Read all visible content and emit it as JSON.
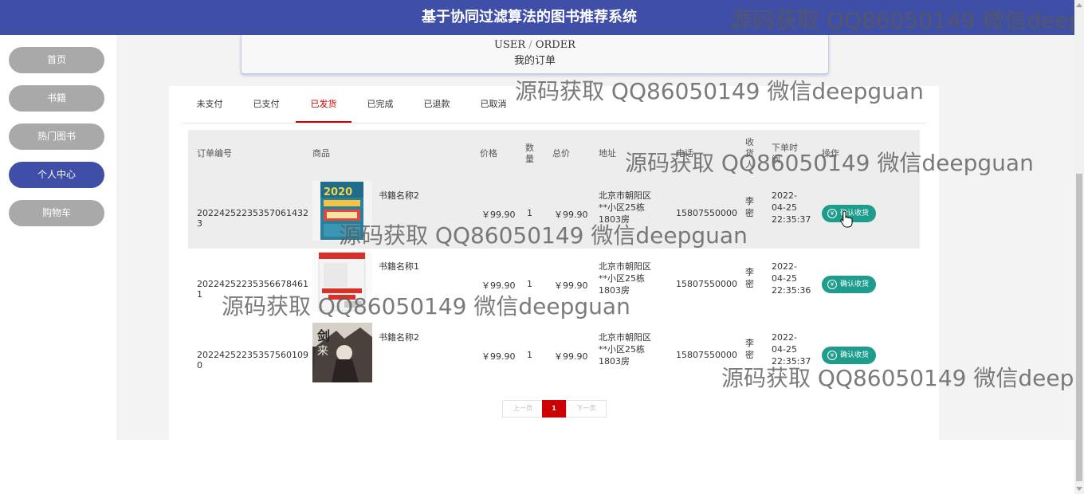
{
  "header": {
    "title": "基于协同过滤算法的图书推荐系统"
  },
  "sidebar": {
    "items": [
      {
        "label": "首页",
        "active": false
      },
      {
        "label": "书籍",
        "active": false
      },
      {
        "label": "热门图书",
        "active": false
      },
      {
        "label": "个人中心",
        "active": true
      },
      {
        "label": "购物车",
        "active": false
      }
    ]
  },
  "breadcrumb": {
    "user": "USER",
    "sep": "/",
    "order": "ORDER",
    "title": "我的订单"
  },
  "tabs": [
    {
      "label": "未支付",
      "active": false
    },
    {
      "label": "已支付",
      "active": false
    },
    {
      "label": "已发货",
      "active": true
    },
    {
      "label": "已完成",
      "active": false
    },
    {
      "label": "已退款",
      "active": false
    },
    {
      "label": "已取消",
      "active": false
    }
  ],
  "table": {
    "headers": {
      "order_no": "订单编号",
      "product": "商品",
      "price": "价格",
      "qty": "数量",
      "total": "总价",
      "address": "地址",
      "phone": "电话",
      "receiver": "收货人",
      "time": "下单时间",
      "action": "操作"
    },
    "rows": [
      {
        "order_no": "20224252235357061432 3",
        "book": "书籍名称2",
        "price": "￥99.90",
        "qty": "1",
        "total": "￥99.90",
        "address": "北京市朝阳区**小区25栋1803房",
        "phone": "15807550000",
        "receiver": "李密",
        "time": "2022-04-25 22:35:37",
        "action": "确认收货",
        "cover": "exam-book"
      },
      {
        "order_no": "20224252235356678461 1",
        "book": "书籍名称1",
        "price": "￥99.90",
        "qty": "1",
        "total": "￥99.90",
        "address": "北京市朝阳区**小区25栋1803房",
        "phone": "15807550000",
        "receiver": "李密",
        "time": "2022-04-25 22:35:36",
        "action": "确认收货",
        "cover": "red-book"
      },
      {
        "order_no": "20224252235357560109 0",
        "book": "书籍名称2",
        "price": "￥99.90",
        "qty": "1",
        "total": "￥99.90",
        "address": "北京市朝阳区**小区25栋1803房",
        "phone": "15807550000",
        "receiver": "李密",
        "time": "2022-04-25 22:35:37",
        "action": "确认收货",
        "cover": "sword-book"
      }
    ]
  },
  "pagination": {
    "prev": "上一页",
    "current": "1",
    "next": "下一页"
  },
  "watermark": "源码获取 QQ86050149 微信deepguan",
  "colors": {
    "primary": "#3f4ea6",
    "nav_inactive": "#a9a9a9",
    "active_tab": "#cc0000",
    "confirm": "#1e9c8c"
  }
}
